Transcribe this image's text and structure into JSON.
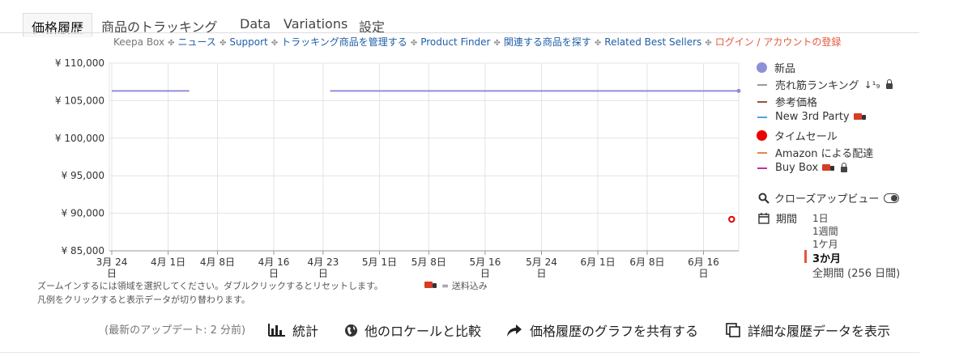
{
  "tabs": [
    {
      "label": "価格履歴",
      "active": true
    },
    {
      "label": "商品のトラッキング"
    },
    {
      "label": "Data"
    },
    {
      "label": "Variations"
    },
    {
      "label": "設定"
    }
  ],
  "subnav": {
    "keepa_box": "Keepa Box",
    "news": "ニュース",
    "support": "Support",
    "manage": "トラッキング商品を管理する",
    "finder": "Product Finder",
    "related": "関連する商品を探す",
    "best_sellers": "Related Best Sellers",
    "login": "ログイン / アカウントの登録",
    "separator": "✤"
  },
  "chart_data": {
    "type": "line",
    "y_ticks": [
      "¥ 110,000",
      "¥ 105,000",
      "¥ 100,000",
      "¥ 95,000",
      "¥ 90,000",
      "¥ 85,000"
    ],
    "ylim": [
      85000,
      110000
    ],
    "x_ticks": [
      {
        "l1": "3月 24",
        "l2": "日"
      },
      {
        "l1": "4月 1日",
        "l2": ""
      },
      {
        "l1": "4月 8日",
        "l2": ""
      },
      {
        "l1": "4月 16",
        "l2": "日"
      },
      {
        "l1": "4月 23",
        "l2": "日"
      },
      {
        "l1": "5月 1日",
        "l2": ""
      },
      {
        "l1": "5月 8日",
        "l2": ""
      },
      {
        "l1": "5月 16",
        "l2": "日"
      },
      {
        "l1": "5月 24",
        "l2": "日"
      },
      {
        "l1": "6月 1日",
        "l2": ""
      },
      {
        "l1": "6月 8日",
        "l2": ""
      },
      {
        "l1": "6月 16",
        "l2": "日"
      }
    ],
    "series": [
      {
        "name": "新品",
        "color": "#8f8fd8",
        "segments": [
          {
            "from": "3月 24日",
            "to": "4月 4日",
            "value": 106300
          },
          {
            "from": "4月 24日",
            "to": "6月 21日",
            "value": 106300
          }
        ]
      },
      {
        "name": "タイムセール",
        "color": "#e00000",
        "points": [
          {
            "x": "6月 20日",
            "value": 89200
          }
        ]
      }
    ]
  },
  "legend": [
    {
      "label": "新品",
      "kind": "dot",
      "color": "#8f8fd8"
    },
    {
      "label": "売れ筋ランキング",
      "kind": "dash",
      "color": "#9a9a9a",
      "extra": "↓¹₉",
      "lock": true
    },
    {
      "label": "参考価格",
      "kind": "dash",
      "color": "#8a5a44"
    },
    {
      "label": "New 3rd Party",
      "kind": "dash",
      "color": "#4fa3d6",
      "truck": true
    },
    {
      "label": "タイムセール",
      "kind": "dot",
      "color": "#ee0000"
    },
    {
      "label": "Amazon による配達",
      "kind": "dash",
      "color": "#e0894f"
    },
    {
      "label": "Buy Box",
      "kind": "dash",
      "color": "#c72ea5",
      "truck": true,
      "lock": true
    }
  ],
  "closeup_label": "クローズアップビュー",
  "period": {
    "label": "期間",
    "options": [
      "1日",
      "1週間",
      "1ケ月",
      "3か月",
      "全期間 (256 日間)"
    ],
    "selected": "3か月"
  },
  "hints": {
    "zoom": "ズームインするには領域を選択してください。ダブルクリックするとリセットします。",
    "shipping": "= 送料込み",
    "legend_click": "凡例をクリックすると表示データが切り替わります。"
  },
  "bottom": {
    "updated": "(最新のアップデート: 2 分前)",
    "stats": "統計",
    "compare": "他のロケールと比較",
    "share": "価格履歴のグラフを共有する",
    "details": "詳細な履歴データを表示"
  }
}
